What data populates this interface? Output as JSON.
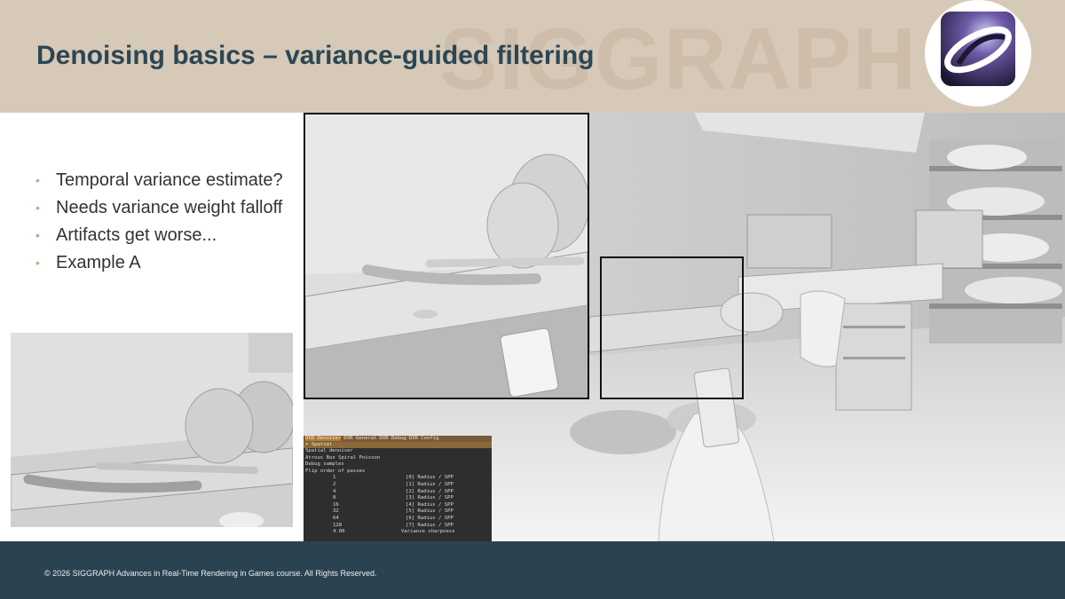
{
  "header": {
    "watermark": "SIGGRAPH",
    "title": "Denoising basics – variance-guided filtering",
    "bullets": [
      "Temporal variance estimate?",
      "Needs variance weight falloff",
      "Artifacts get worse...",
      "Example A"
    ],
    "bullet_glyph": "•"
  },
  "debug_panel": {
    "tabs": [
      "DXR Denoiser",
      "DXR General",
      "DXR Debug",
      "DXR Config"
    ],
    "section": "▾ Spatial",
    "toggle_label": "Spatial denoiser",
    "filter_options": [
      "Atrous",
      "Box",
      "Spiral",
      "Poisson"
    ],
    "debug_samples": "Debug samples",
    "flip_order": "Flip order of passes",
    "passes": [
      {
        "value": "1",
        "label": "[0] Radius / SPP"
      },
      {
        "value": "2",
        "label": "[1] Radius / SPP"
      },
      {
        "value": "4",
        "label": "[2] Radius / SPP"
      },
      {
        "value": "8",
        "label": "[3] Radius / SPP"
      },
      {
        "value": "16",
        "label": "[4] Radius / SPP"
      },
      {
        "value": "32",
        "label": "[5] Radius / SPP"
      },
      {
        "value": "64",
        "label": "[6] Radius / SPP"
      },
      {
        "value": "128",
        "label": "[7] Radius / SPP"
      }
    ],
    "sharpness_value": "4.00",
    "sharpness_label": "Variance sharpness"
  },
  "footer": {
    "copyright": "© 2026 SIGGRAPH Advances in Real-Time Rendering in Games course. All Rights Reserved."
  },
  "colors": {
    "header_bg": "#d6c9b8",
    "title": "#2c4654",
    "bullet_dot": "#c8a882",
    "footer_bg": "#2b4350"
  }
}
